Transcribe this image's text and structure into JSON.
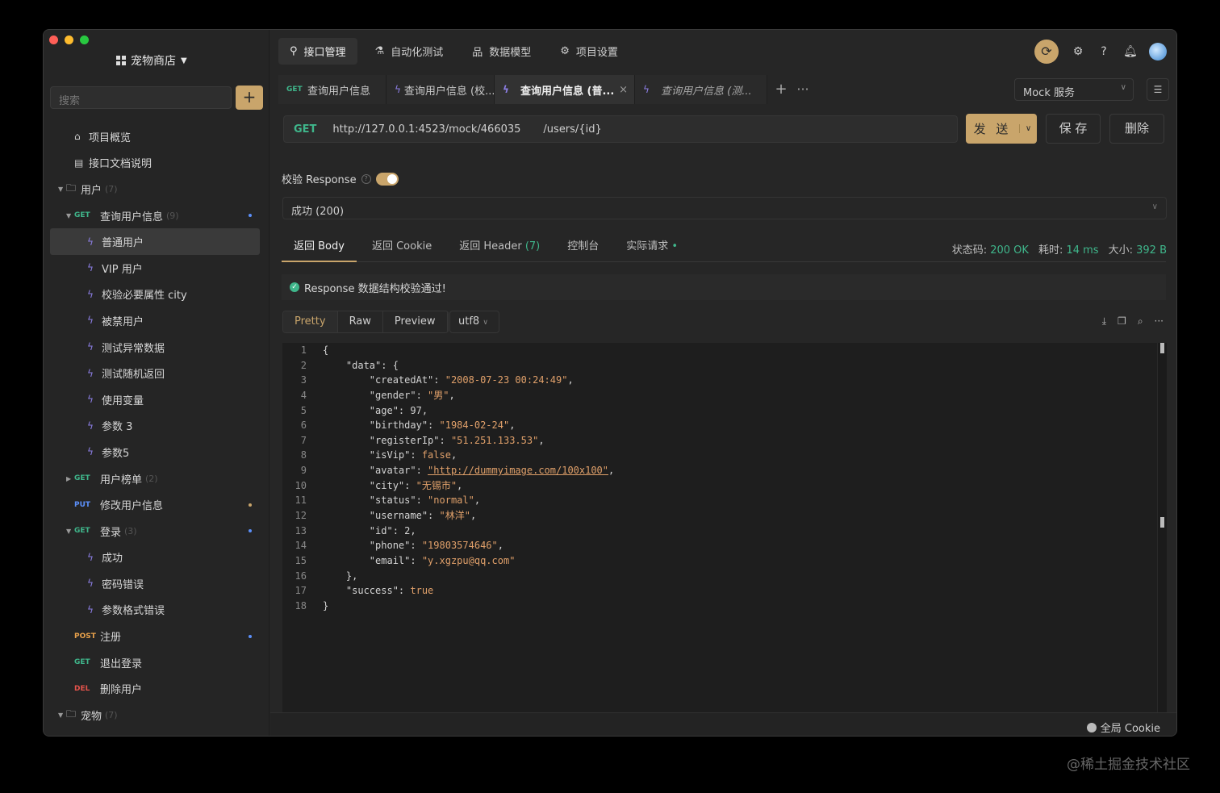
{
  "sidebar": {
    "project_name": "宠物商店",
    "search_placeholder": "搜索",
    "add_label": "+",
    "items": [
      {
        "type": "page",
        "label": "项目概览",
        "icon": "home-icon"
      },
      {
        "type": "page",
        "label": "接口文档说明",
        "icon": "doc-icon"
      },
      {
        "type": "folder",
        "label": "用户",
        "count": "(7)"
      },
      {
        "type": "api",
        "method": "GET",
        "label": "查询用户信息",
        "count": "(9)"
      },
      {
        "type": "case",
        "label": "普通用户",
        "selected": true
      },
      {
        "type": "case",
        "label": "VIP 用户"
      },
      {
        "type": "case",
        "label": "校验必要属性 city"
      },
      {
        "type": "case",
        "label": "被禁用户"
      },
      {
        "type": "case",
        "label": "测试异常数据"
      },
      {
        "type": "case",
        "label": "测试随机返回"
      },
      {
        "type": "case",
        "label": "使用变量"
      },
      {
        "type": "case",
        "label": "参数 3"
      },
      {
        "type": "case",
        "label": "参数5"
      },
      {
        "type": "api",
        "method": "GET",
        "label": "用户榜单",
        "count": "(2)"
      },
      {
        "type": "api",
        "method": "PUT",
        "label": "修改用户信息"
      },
      {
        "type": "api",
        "method": "GET",
        "label": "登录",
        "count": "(3)"
      },
      {
        "type": "case",
        "label": "成功"
      },
      {
        "type": "case",
        "label": "密码错误"
      },
      {
        "type": "case",
        "label": "参数格式错误"
      },
      {
        "type": "api",
        "method": "POST",
        "label": "注册"
      },
      {
        "type": "api",
        "method": "GET",
        "label": "退出登录"
      },
      {
        "type": "api",
        "method": "DEL",
        "label": "删除用户"
      },
      {
        "type": "folder",
        "label": "宠物",
        "count": "(7)"
      }
    ]
  },
  "topnav": {
    "api_manage": "接口管理",
    "auto_test": "自动化测试",
    "data_model": "数据模型",
    "project_settings": "项目设置"
  },
  "tabs": {
    "tab1_method": "GET",
    "tab1_label": "查询用户信息",
    "tab2_label": "查询用户信息 (校...",
    "tab3_label": "查询用户信息 (普...",
    "tab4_label": "查询用户信息 (测...",
    "plus": "+",
    "more": "···"
  },
  "env": {
    "mock_label": "Mock 服务"
  },
  "request": {
    "method": "GET",
    "base_url": "http://127.0.0.1:4523/mock/466035",
    "path": "/users/{id}",
    "send_label": "发 送",
    "save_label": "保 存",
    "delete_label": "删除"
  },
  "validate": {
    "label": "校验 Response",
    "enabled": true
  },
  "response": {
    "status_option": "成功 (200)",
    "tabs": {
      "body": "返回 Body",
      "cookie": "返回 Cookie",
      "header": "返回 Header",
      "header_count": "(7)",
      "console": "控制台",
      "actual": "实际请求"
    },
    "meta": {
      "status_label": "状态码:",
      "status_value": "200 OK",
      "time_label": "耗时:",
      "time_value": "14 ms",
      "size_label": "大小:",
      "size_value": "392 B"
    },
    "ok_message": "Response 数据结构校验通过!",
    "view": {
      "pretty": "Pretty",
      "raw": "Raw",
      "preview": "Preview",
      "encoding": "utf8"
    },
    "code_lines": [
      "{",
      "    \"data\": {",
      "        \"createdAt\": \"2008-07-23 00:24:49\",",
      "        \"gender\": \"男\",",
      "        \"age\": 97,",
      "        \"birthday\": \"1984-02-24\",",
      "        \"registerIp\": \"51.251.133.53\",",
      "        \"isVip\": false,",
      "        \"avatar\": \"http://dummyimage.com/100x100\",",
      "        \"city\": \"无锡市\",",
      "        \"status\": \"normal\",",
      "        \"username\": \"林洋\",",
      "        \"id\": 2,",
      "        \"phone\": \"19803574646\",",
      "        \"email\": \"y.xgzpu@qq.com\"",
      "    },",
      "    \"success\": true",
      "}"
    ]
  },
  "footer": {
    "cookie_label": "全局 Cookie"
  },
  "watermark": "@稀土掘金技术社区",
  "colors": {
    "accent": "#c9a56b",
    "get": "#3fb68b",
    "put": "#5b8ff9",
    "post": "#e8a14b",
    "del": "#e5534b"
  }
}
